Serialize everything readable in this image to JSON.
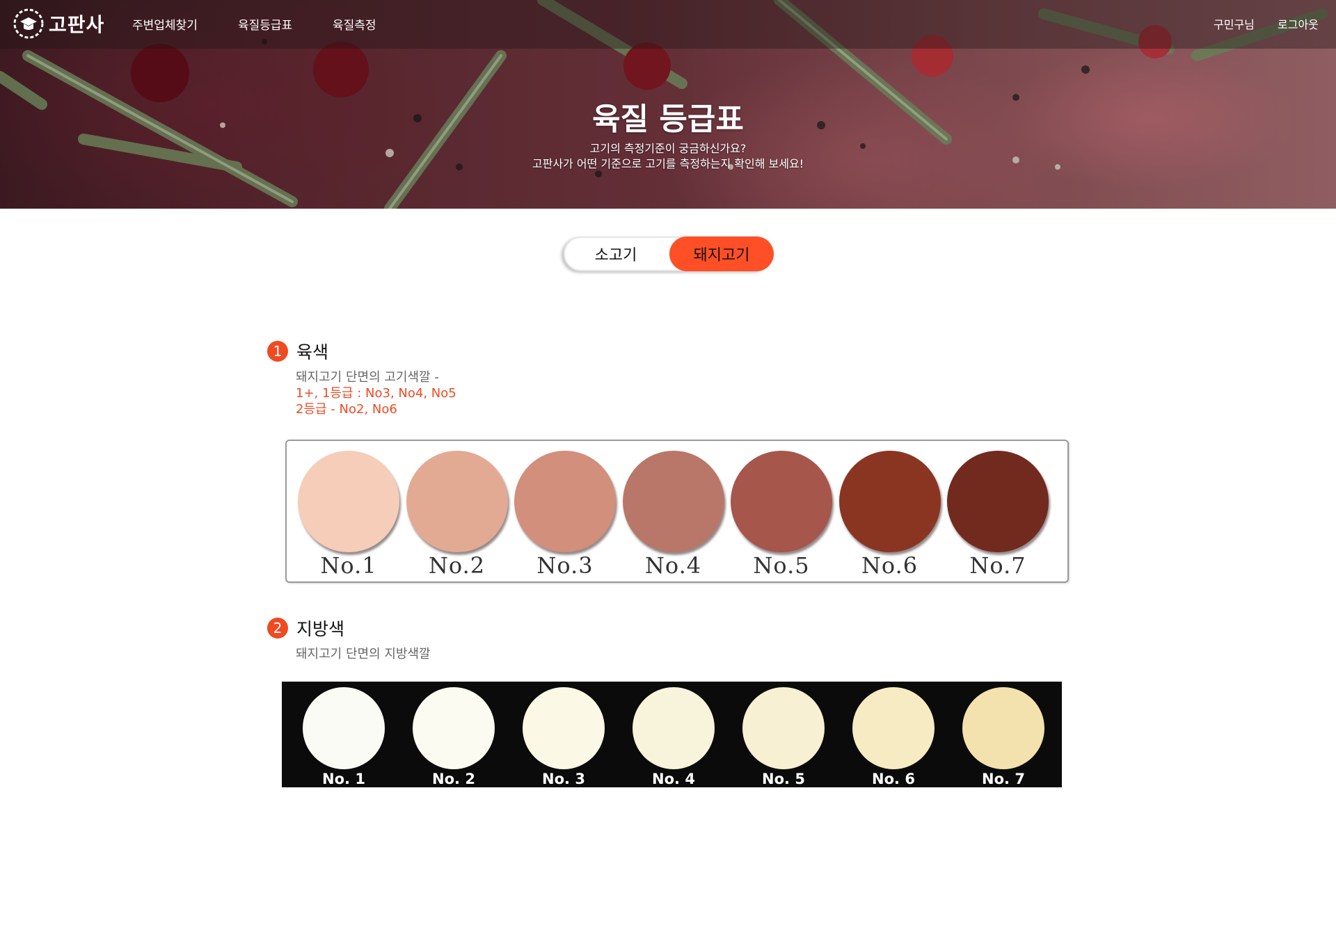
{
  "nav": {
    "logo_text": "고판사",
    "links": [
      "주변업체찾기",
      "육질등급표",
      "육질측정"
    ],
    "user_label": "구민구님",
    "logout_label": "로그아웃"
  },
  "hero": {
    "title": "육질 등급표",
    "subtitle_line1": "고기의 측정기준이 궁금하신가요?",
    "subtitle_line2": "고판사가 어떤 기준으로 고기를 측정하는지 확인해 보세요!"
  },
  "toggle": {
    "options": [
      "소고기",
      "돼지고기"
    ],
    "selected": "돼지고기",
    "selected_color": "#ff4f26"
  },
  "sections": [
    {
      "number": "1",
      "title": "육색",
      "description": "돼지고기 단면의 고기색깔 -",
      "grade_lines": [
        "1+, 1등급 : No3, No4, No5",
        "2등급 - No2, No6"
      ],
      "swatches": [
        {
          "label": "No.1",
          "color": "#f6cdb9"
        },
        {
          "label": "No.2",
          "color": "#e3aa93"
        },
        {
          "label": "No.3",
          "color": "#d28f7b"
        },
        {
          "label": "No.4",
          "color": "#b97769"
        },
        {
          "label": "No.5",
          "color": "#a6564a"
        },
        {
          "label": "No.6",
          "color": "#8a3522"
        },
        {
          "label": "No.7",
          "color": "#722a1f"
        }
      ]
    },
    {
      "number": "2",
      "title": "지방색",
      "description": "돼지고기 단면의 지방색깔",
      "swatches": [
        {
          "label": "No. 1",
          "color": "#fbfbf6"
        },
        {
          "label": "No. 2",
          "color": "#fbfbf1"
        },
        {
          "label": "No. 3",
          "color": "#fbf9e6"
        },
        {
          "label": "No. 4",
          "color": "#f8f3db"
        },
        {
          "label": "No. 5",
          "color": "#f8f0d2"
        },
        {
          "label": "No. 6",
          "color": "#f6ebc2"
        },
        {
          "label": "No. 7",
          "color": "#f3e2ad"
        }
      ]
    }
  ],
  "accent_color": "#f04a23"
}
